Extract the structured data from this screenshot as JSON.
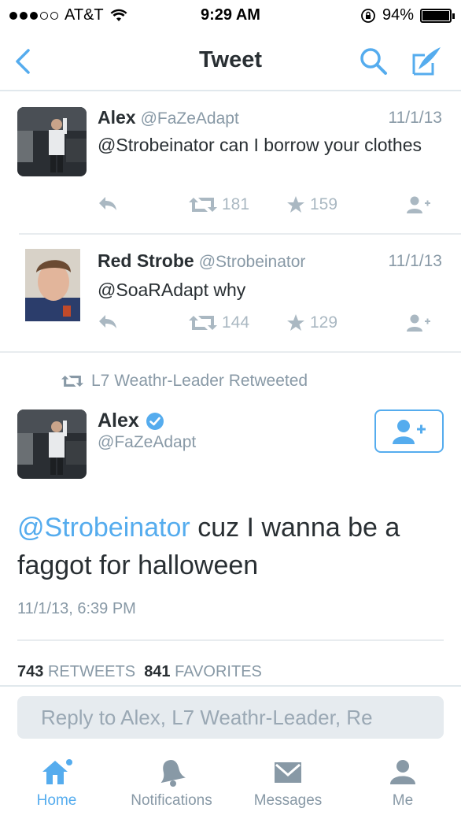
{
  "status_bar": {
    "carrier": "AT&T",
    "time": "9:29 AM",
    "battery": "94%"
  },
  "nav": {
    "title": "Tweet"
  },
  "tweets": [
    {
      "name": "Alex",
      "handle": "@FaZeAdapt",
      "date": "11/1/13",
      "text": "@Strobeinator can I borrow your clothes",
      "retweets": "181",
      "favorites": "159"
    },
    {
      "name": "Red Strobe",
      "handle": "@Strobeinator",
      "date": "11/1/13",
      "text": "@SoaRAdapt why",
      "retweets": "144",
      "favorites": "129"
    }
  ],
  "main_tweet": {
    "retweeted_by": "L7 Weathr-Leader Retweeted",
    "name": "Alex",
    "handle": "@FaZeAdapt",
    "mention": "@Strobeinator",
    "text": " cuz I wanna be a faggot for halloween",
    "timestamp": "11/1/13, 6:39 PM",
    "retweet_count": "743",
    "retweet_label": "RETWEETS",
    "favorite_count": "841",
    "favorite_label": "FAVORITES"
  },
  "reply": {
    "placeholder": "Reply to Alex, L7 Weathr-Leader, Re"
  },
  "tabs": [
    {
      "label": "Home"
    },
    {
      "label": "Notifications"
    },
    {
      "label": "Messages"
    },
    {
      "label": "Me"
    }
  ],
  "colors": {
    "accent": "#55acee",
    "muted": "#8899a6",
    "text": "#292f33",
    "divider": "#e1e8ed"
  }
}
